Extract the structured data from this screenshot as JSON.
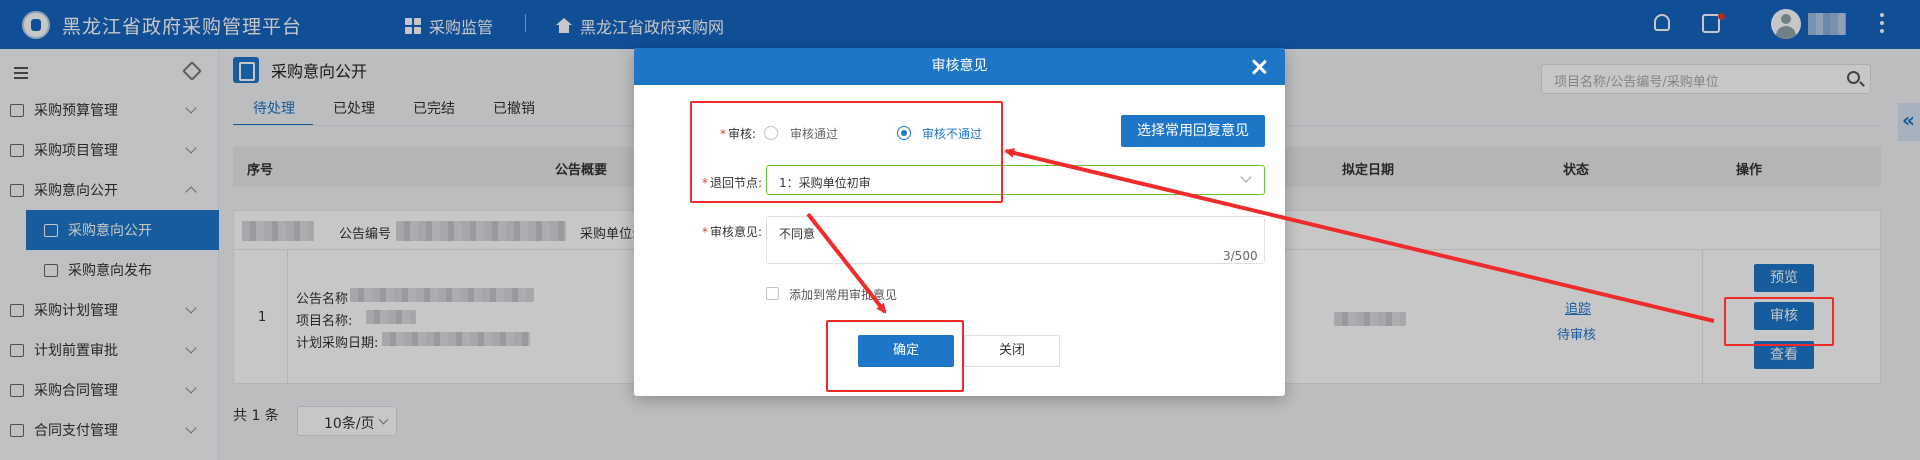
{
  "header": {
    "title": "黑龙江省政府采购管理平台",
    "nav": [
      {
        "label": "采购监管",
        "icon": "grid-icon"
      },
      {
        "label": "黑龙江省政府采购网",
        "icon": "home-icon"
      }
    ]
  },
  "sidebar": {
    "items": [
      {
        "label": "采购预算管理",
        "icon": "budget-icon"
      },
      {
        "label": "采购项目管理",
        "icon": "project-icon"
      },
      {
        "label": "采购意向公开",
        "icon": "intent-icon"
      },
      {
        "label": "采购意向公开",
        "icon": "doc-icon"
      },
      {
        "label": "采购意向发布",
        "icon": "chart-icon"
      },
      {
        "label": "采购计划管理",
        "icon": "plan-icon"
      },
      {
        "label": "计划前置审批",
        "icon": "approval-icon"
      },
      {
        "label": "采购合同管理",
        "icon": "contract-icon"
      },
      {
        "label": "合同支付管理",
        "icon": "payment-icon"
      }
    ]
  },
  "page": {
    "title": "采购意向公开",
    "search_placeholder": "项目名称/公告编号/采购单位",
    "tabs": [
      "待处理",
      "已处理",
      "已完结",
      "已撤销"
    ]
  },
  "table": {
    "headers": {
      "index": "序号",
      "summary": "公告概要",
      "date": "拟定日期",
      "status": "状态",
      "actions": "操作"
    },
    "filter": {
      "notice_no": "公告编号",
      "unit": "采购单位:"
    },
    "row": {
      "index": "1",
      "notice_name": "公告名称",
      "project_name": "项目名称:",
      "plan_date": "计划采购日期:",
      "status_link": "追踪",
      "status_text": "待审核",
      "btn_preview": "预览",
      "btn_review": "审核",
      "btn_view": "查看"
    }
  },
  "pager": {
    "total": "共 1 条",
    "size": "10条/页"
  },
  "dialog": {
    "title": "审核意见",
    "review_label": "审核:",
    "option_pass": "审核通过",
    "option_fail": "审核不通过",
    "quick_reply": "选择常用回复意见",
    "return_label": "退回节点:",
    "return_value": "1：采购单位初审",
    "opinion_label": "审核意见:",
    "opinion_value": "不同意",
    "opinion_count": "3/500",
    "add_common": "添加到常用审批意见",
    "confirm": "确定",
    "close": "关闭"
  },
  "colors": {
    "brand": "#1565c0",
    "primary": "#1e76c9",
    "annotation": "#ef2b2b",
    "select_border": "#67c23a"
  }
}
